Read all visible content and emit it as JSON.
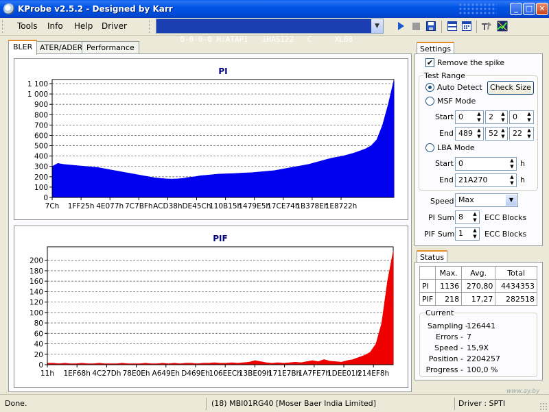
{
  "window": {
    "title": "KProbe v2.5.2 - Designed by Karr"
  },
  "menu": {
    "tools": "Tools",
    "info": "Info",
    "help": "Help",
    "driver": "Driver"
  },
  "drive": {
    "selected": "0-0-0-0 H:ATAPI   iHAS122   C     XL08"
  },
  "tabs": {
    "bler": "BLER",
    "ater": "ATER/ADER",
    "performance": "Performance"
  },
  "colors": {
    "pi_fill": "#0000ee",
    "pif_fill": "#ee0000",
    "grid": "#707070",
    "title_blue": "#000080"
  },
  "chart_data": [
    {
      "type": "area",
      "title": "PI",
      "ylim": [
        0,
        1100
      ],
      "yticks": [
        0,
        100,
        200,
        300,
        400,
        500,
        600,
        700,
        800,
        900,
        1000,
        1100
      ],
      "ytick_labels": [
        "0",
        "100",
        "200",
        "300",
        "400",
        "500",
        "600",
        "700",
        "800",
        "900",
        "1 000",
        "1 100"
      ],
      "xtick_labels": [
        "7Ch",
        "1FF25h",
        "4E077h",
        "7C7BFh",
        "ACD38h",
        "DE45Ch",
        "110B15h",
        "1479E5h",
        "17CE74h",
        "1B378Eh",
        "1E8722h"
      ],
      "grid": true,
      "series": [
        {
          "values": [
            300,
            330,
            320,
            315,
            310,
            305,
            300,
            295,
            290,
            280,
            270,
            260,
            250,
            240,
            230,
            220,
            210,
            200,
            190,
            185,
            180,
            178,
            180,
            185,
            195,
            200,
            210,
            215,
            220,
            225,
            228,
            230,
            232,
            235,
            238,
            240,
            245,
            250,
            255,
            260,
            270,
            280,
            290,
            300,
            310,
            320,
            335,
            350,
            365,
            380,
            390,
            400,
            415,
            430,
            450,
            470,
            500,
            560,
            700,
            900,
            1136
          ]
        }
      ]
    },
    {
      "type": "area",
      "title": "PIF",
      "ylim": [
        0,
        218
      ],
      "yticks": [
        0,
        20,
        40,
        60,
        80,
        100,
        120,
        140,
        160,
        180,
        200
      ],
      "ytick_labels": [
        "0",
        "20",
        "40",
        "60",
        "80",
        "100",
        "120",
        "140",
        "160",
        "180",
        "200"
      ],
      "xtick_labels": [
        "11h",
        "1EF68h",
        "4C27Dh",
        "78E0Eh",
        "A649Eh",
        "D469Eh",
        "106EECh",
        "13BE09h",
        "171E7Bh",
        "1A7FE7h",
        "1DEE01h",
        "214EF8h"
      ],
      "grid": true,
      "series": [
        {
          "values": [
            3,
            3,
            2,
            3,
            2,
            2,
            3,
            2,
            2,
            3,
            2,
            2,
            2,
            3,
            2,
            2,
            2,
            3,
            2,
            2,
            3,
            2,
            3,
            2,
            3,
            3,
            2,
            3,
            3,
            4,
            3,
            3,
            4,
            3,
            4,
            5,
            8,
            6,
            4,
            3,
            4,
            3,
            4,
            5,
            4,
            6,
            8,
            6,
            10,
            7,
            6,
            5,
            8,
            10,
            14,
            18,
            24,
            40,
            80,
            160,
            218
          ]
        }
      ]
    }
  ],
  "settings": {
    "tab": "Settings",
    "remove_spike": "Remove the spike",
    "remove_spike_checked": true,
    "test_range": "Test Range",
    "auto_detect": "Auto Detect",
    "check_size": "Check Size",
    "msf_mode": "MSF Mode",
    "start_label": "Start",
    "end_label": "End",
    "msf_start": [
      "0",
      "2",
      "0"
    ],
    "msf_end": [
      "489",
      "52",
      "22"
    ],
    "lba_mode": "LBA Mode",
    "lba_start": "0",
    "lba_end": "21A270",
    "h_unit": "h",
    "speed_label": "Speed",
    "speed_value": "Max",
    "pi_sum_label": "PI Sum",
    "pi_sum_value": "8",
    "pif_sum_label": "PIF Sum",
    "pif_sum_value": "1",
    "ecc_blocks": "ECC Blocks"
  },
  "status": {
    "tab": "Status",
    "headers": [
      "Max.",
      "Avg.",
      "Total"
    ],
    "rows": [
      {
        "label": "PI",
        "max": "1136",
        "avg": "270,80",
        "total": "4434353"
      },
      {
        "label": "PIF",
        "max": "218",
        "avg": "17,27",
        "total": "282518"
      }
    ],
    "current": "Current",
    "sampling_label": "Sampling -",
    "sampling": "126441",
    "errors_label": "Errors -",
    "errors": "7",
    "speed_label": "Speed -",
    "speed": "15,9X",
    "position_label": "Position -",
    "position": "2204257",
    "progress_label": "Progress -",
    "progress": "100,0 %"
  },
  "statusbar": {
    "state": "Done.",
    "disc": "(18) MBI01RG40 [Moser Baer India Limited]",
    "driver": "Driver : SPTI"
  },
  "watermark": "www.ay.by"
}
